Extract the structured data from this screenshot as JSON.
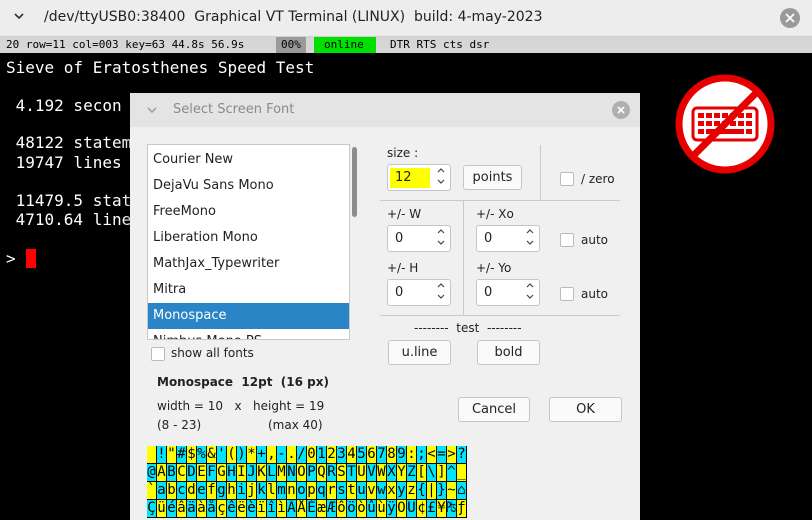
{
  "window": {
    "title": "/dev/ttyUSB0:38400  Graphical VT Terminal (LINUX)  build: 4-may-2023"
  },
  "statusbar": {
    "info": "20 row=11 col=003 key=63 44.8s 56.9s",
    "percent": "00%",
    "online": "online",
    "signals": "DTR RTS cts dsr",
    "colors": {
      "bar": "#d6d6d6",
      "online": "#00e000",
      "percent": "#9a9a9a"
    }
  },
  "terminal": {
    "lines": [
      "Sieve of Eratosthenes Speed Test",
      "",
      " 4.192 secon",
      "",
      " 48122 statem",
      " 19747 lines",
      "",
      " 11479.5 stat",
      " 4710.64 line",
      "",
      "> "
    ],
    "cursor_color": "#ff0000"
  },
  "overlay_icon": "no-keyboard-icon",
  "dialog": {
    "title": "Select Screen Font",
    "fonts": [
      "Courier New",
      "DejaVu Sans Mono",
      "FreeMono",
      "Liberation Mono",
      "MathJax_Typewriter",
      "Mitra",
      "Monospace",
      "Nimbus Mono PS"
    ],
    "selected_font": "Monospace",
    "show_all_fonts_label": "show all fonts",
    "size_label": "size :",
    "size_value": "12",
    "points_button": "points",
    "zero_label": "/ zero",
    "w_label": "+/- W",
    "w_value": "0",
    "xo_label": "+/- Xo",
    "xo_value": "0",
    "h_label": "+/- H",
    "h_value": "0",
    "yo_label": "+/- Yo",
    "yo_value": "0",
    "auto_label": "auto",
    "test_label": "--------  test  --------",
    "uline_button": "u.line",
    "bold_button": "bold",
    "font_info": "Monospace  12pt  (16 px)",
    "width_info": "width = 10   x   height = 19",
    "width_range": "(8 - 23)",
    "height_range": "(max 40)",
    "cancel_button": "Cancel",
    "ok_button": "OK",
    "char_rows": [
      " !\"#$%&'()*+,-./0123456789:;<=>?",
      "@ABCDEFGHIJKLMNOPQRSTUVWXYZ[\\]^_",
      "`abcdefghijklmnopqrstuvwxyz{|}~⌂",
      "ÇüéâäàåçêëèïîìÄÅÉæÆôöòûùÿÖÜ¢£¥₧ƒ"
    ],
    "char_colors": [
      "#ffff00",
      "#00e5ff"
    ]
  }
}
